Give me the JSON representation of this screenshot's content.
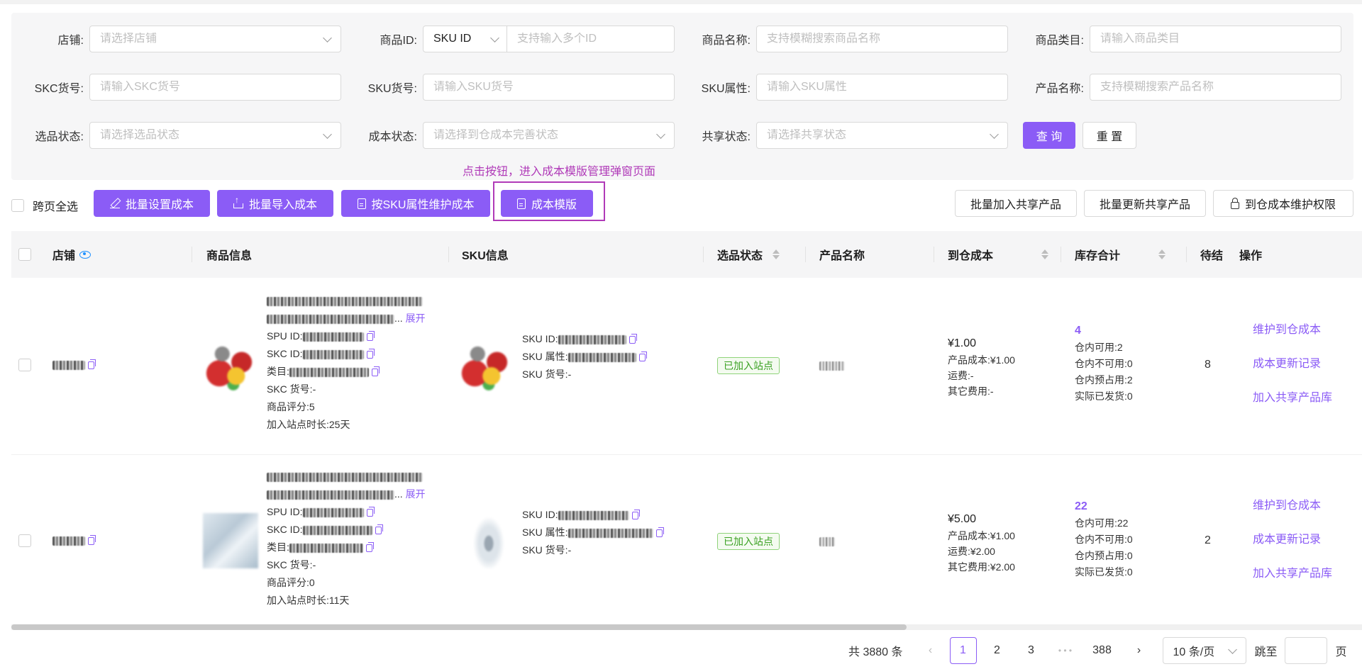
{
  "filters": {
    "shop": {
      "label": "店铺:",
      "placeholder": "请选择店铺"
    },
    "product_id": {
      "label": "商品ID:",
      "type_value": "SKU ID",
      "placeholder": "支持输入多个ID"
    },
    "product_name": {
      "label": "商品名称:",
      "placeholder": "支持模糊搜索商品名称"
    },
    "category": {
      "label": "商品类目:",
      "placeholder": "请输入商品类目"
    },
    "skc_no": {
      "label": "SKC货号:",
      "placeholder": "请输入SKC货号"
    },
    "sku_no": {
      "label": "SKU货号:",
      "placeholder": "请输入SKU货号"
    },
    "sku_attr": {
      "label": "SKU属性:",
      "placeholder": "请输入SKU属性"
    },
    "goods_name": {
      "label": "产品名称:",
      "placeholder": "支持模糊搜索产品名称"
    },
    "select_status": {
      "label": "选品状态:",
      "placeholder": "请选择选品状态"
    },
    "cost_status": {
      "label": "成本状态:",
      "placeholder": "请选择到仓成本完善状态"
    },
    "share_status": {
      "label": "共享状态:",
      "placeholder": "请选择共享状态"
    },
    "query_label": "查 询",
    "reset_label": "重 置"
  },
  "hint": "点击按钮，进入成本模版管理弹窗页面",
  "toolbar": {
    "select_all": "跨页全选",
    "batch_set_cost": "批量设置成本",
    "batch_import_cost": "批量导入成本",
    "sku_attr_cost": "按SKU属性维护成本",
    "cost_template": "成本模版",
    "batch_add_share": "批量加入共享产品",
    "batch_update_share": "批量更新共享产品",
    "cost_permission": "到仓成本维护权限"
  },
  "columns": {
    "shop": "店铺",
    "product_info": "商品信息",
    "sku_info": "SKU信息",
    "select_status": "选品状态",
    "goods_name": "产品名称",
    "warehouse_cost": "到仓成本",
    "stock_total": "库存合计",
    "pending": "待结",
    "actions": "操作"
  },
  "labels": {
    "expand": "展开",
    "spu_id": "SPU ID:",
    "skc_id": "SKC ID:",
    "category": "类目:",
    "skc_no": "SKC 货号:",
    "rating": "商品评分:",
    "days_on_site": "加入站点时长:",
    "sku_id": "SKU ID:",
    "sku_attr": "SKU 属性:",
    "sku_no": "SKU 货号:",
    "product_cost": "产品成本:",
    "shipping": "运费:",
    "other_cost": "其它费用:",
    "in_stock_available": "仓内可用:",
    "in_stock_unavailable": "仓内不可用:",
    "in_stock_reserved": "仓内预占用:",
    "actual_shipped": "实际已发货:",
    "op_maintain_cost": "维护到仓成本",
    "op_cost_history": "成本更新记录",
    "op_add_share": "加入共享产品库"
  },
  "rows": [
    {
      "title_ellipsis": "...",
      "skc_no": "-",
      "rating": "5",
      "days": "25天",
      "sku_no": "-",
      "status": "已加入站点",
      "cost": "¥1.00",
      "product_cost": "¥1.00",
      "shipping": "-",
      "other_cost": "-",
      "stock_total": "4",
      "available": "2",
      "unavailable": "0",
      "reserved": "2",
      "shipped": "0",
      "pending": "8"
    },
    {
      "title_ellipsis": "...",
      "skc_no": "-",
      "rating": "0",
      "days": "11天",
      "sku_no": "-",
      "status": "已加入站点",
      "cost": "¥5.00",
      "product_cost": "¥1.00",
      "shipping": "¥2.00",
      "other_cost": "¥2.00",
      "stock_total": "22",
      "available": "22",
      "unavailable": "0",
      "reserved": "0",
      "shipped": "0",
      "pending": "2"
    }
  ],
  "pagination": {
    "total": "共 3880 条",
    "pages": [
      "1",
      "2",
      "3"
    ],
    "ellipsis": "• • •",
    "last": "388",
    "page_size": "10 条/页",
    "jump_label": "跳至",
    "page_suffix": "页",
    "prev": "‹",
    "next": "›"
  }
}
